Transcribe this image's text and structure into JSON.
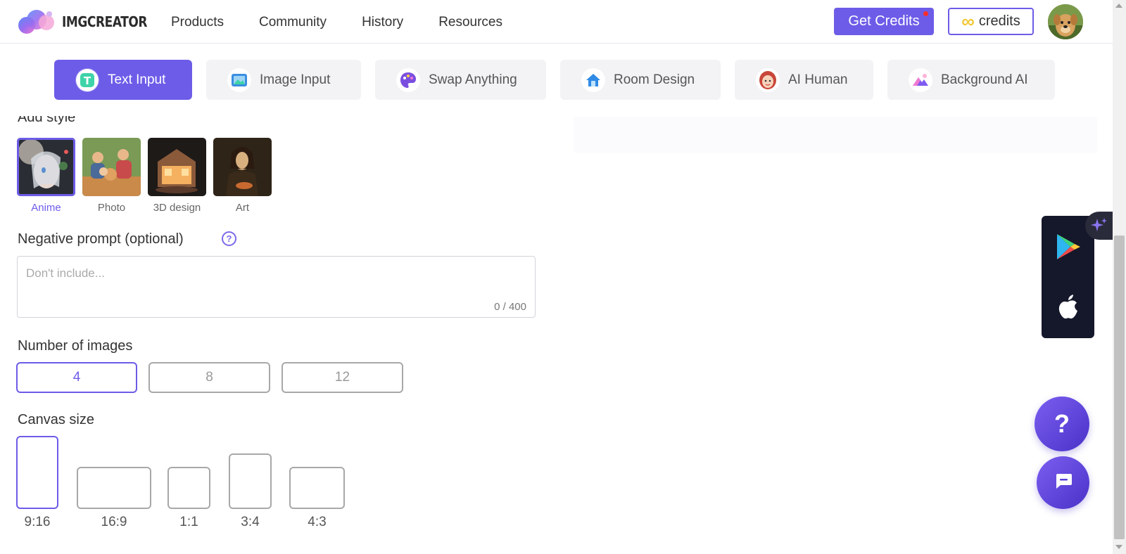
{
  "header": {
    "logo_text": "IMGCREATOR",
    "nav": [
      "Products",
      "Community",
      "History",
      "Resources"
    ],
    "get_credits_label": "Get Credits",
    "credits_symbol": "∞",
    "credits_label": "credits"
  },
  "tabs": [
    {
      "label": "Text Input",
      "icon": "text-t-icon",
      "active": true
    },
    {
      "label": "Image Input",
      "icon": "image-icon",
      "active": false
    },
    {
      "label": "Swap Anything",
      "icon": "palette-icon",
      "active": false
    },
    {
      "label": "Room Design",
      "icon": "house-icon",
      "active": false
    },
    {
      "label": "AI Human",
      "icon": "woman-face-icon",
      "active": false
    },
    {
      "label": "Background AI",
      "icon": "mountain-image-icon",
      "active": false
    }
  ],
  "form": {
    "add_style_label": "Add style",
    "styles": [
      {
        "label": "Anime",
        "active": true
      },
      {
        "label": "Photo",
        "active": false
      },
      {
        "label": "3D design",
        "active": false
      },
      {
        "label": "Art",
        "active": false
      }
    ],
    "negative_prompt_label": "Negative prompt (optional)",
    "negative_prompt_placeholder": "Don't include...",
    "negative_prompt_value": "",
    "negative_prompt_counter": "0 / 400",
    "number_of_images_label": "Number of images",
    "number_options": [
      "4",
      "8",
      "12"
    ],
    "number_selected": "4",
    "canvas_size_label": "Canvas size",
    "canvas_options": [
      "9:16",
      "16:9",
      "1:1",
      "3:4",
      "4:3"
    ],
    "canvas_selected": "9:16"
  },
  "floating": {
    "help_label": "?",
    "apps": [
      "google-play-icon",
      "apple-icon"
    ]
  },
  "colors": {
    "accent": "#6d5ce8",
    "credits_infinity": "#f0c93a",
    "app_panel_bg": "#15172a"
  }
}
